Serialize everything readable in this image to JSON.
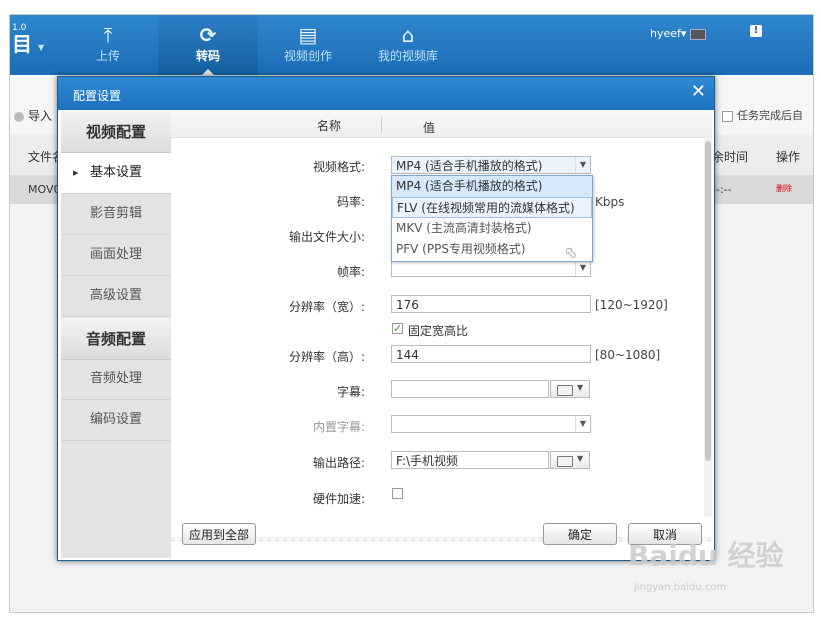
{
  "app": {
    "version": "1.0",
    "nav": [
      {
        "label": "上传",
        "icon": "upload-icon",
        "glyph": "⤒"
      },
      {
        "label": "转码",
        "icon": "transcode-icon",
        "glyph": "⟳"
      },
      {
        "label": "视频创作",
        "icon": "film-icon",
        "glyph": "▤"
      },
      {
        "label": "我的视频库",
        "icon": "home-icon",
        "glyph": "⌂"
      }
    ],
    "user": "hyeef"
  },
  "toolbar": {
    "import_label": "导入",
    "after_done_label": "任务完成后自"
  },
  "table": {
    "headers": {
      "file": "文件名",
      "remaining": "余时间",
      "action": "操作"
    },
    "row": {
      "name": "MOV0",
      "time": "--:--",
      "action": "删除"
    }
  },
  "dialog": {
    "title": "配置设置",
    "close_glyph": "✕",
    "sidebar": {
      "video_header": "视频配置",
      "video_items": [
        "基本设置",
        "影音剪辑",
        "画面处理",
        "高级设置"
      ],
      "audio_header": "音频配置",
      "audio_items": [
        "音频处理",
        "编码设置"
      ]
    },
    "columns": {
      "name": "名称",
      "value": "值"
    },
    "fields": {
      "format_label": "视频格式:",
      "format_value": "MP4 (适合手机播放的格式)",
      "bitrate_label": "码率:",
      "bitrate_unit": "Kbps",
      "filesize_label": "输出文件大小:",
      "framerate_label": "帧率:",
      "width_label": "分辨率（宽）:",
      "width_value": "176",
      "width_range": "[120~1920]",
      "keep_ratio_label": "固定宽高比",
      "height_label": "分辨率（高）:",
      "height_value": "144",
      "height_range": "[80~1080]",
      "subtitle_label": "字幕:",
      "embedded_subtitle_label": "内置字幕:",
      "output_label": "输出路径:",
      "output_value": "F:\\手机视频",
      "hw_accel_label": "硬件加速:"
    },
    "format_options": [
      "MP4 (适合手机播放的格式)",
      "FLV (在线视频常用的流媒体格式)",
      "MKV (主流高清封装格式)",
      "PFV (PPS专用视频格式)"
    ],
    "buttons": {
      "apply_all": "应用到全部",
      "ok": "确定",
      "cancel": "取消"
    }
  },
  "watermark": {
    "text": "Baidu 经验",
    "url": "jingyan.baidu.com"
  }
}
